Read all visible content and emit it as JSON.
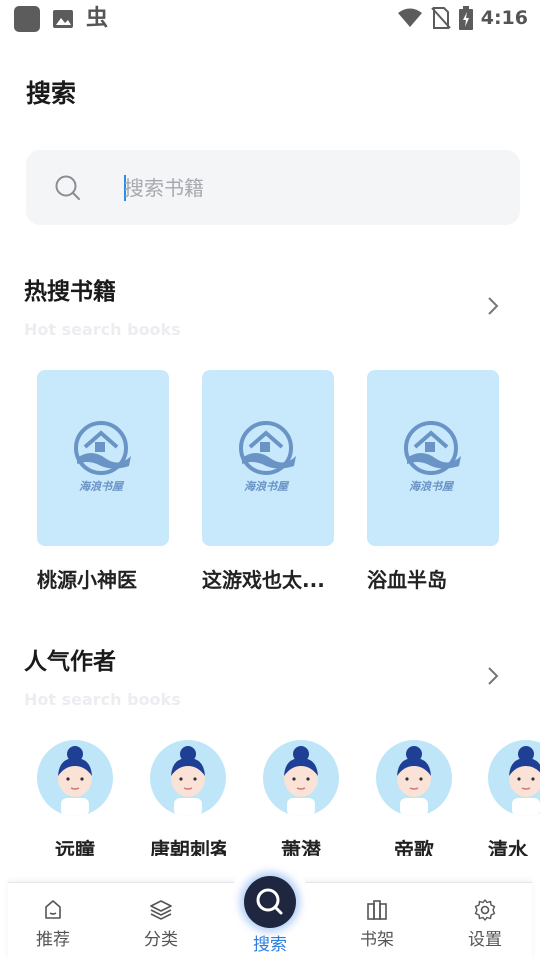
{
  "status_bar": {
    "time": "4:16",
    "left_icons": [
      "app-square-icon",
      "image-icon",
      "bug-icon"
    ],
    "right_icons": [
      "wifi-icon",
      "no-sim-icon",
      "battery-charging-icon"
    ],
    "bug_glyph": "虫"
  },
  "page": {
    "title": "搜索"
  },
  "search": {
    "placeholder": "搜索书籍"
  },
  "hot_books": {
    "title": "热搜书籍",
    "subtitle": "Hot search books",
    "books": [
      {
        "title": "桃源小神医",
        "cover_logo_text": "海浪书屋"
      },
      {
        "title": "这游戏也太...",
        "cover_logo_text": "海浪书屋"
      },
      {
        "title": "浴血半岛",
        "cover_logo_text": "海浪书屋"
      }
    ]
  },
  "popular_authors": {
    "title": "人气作者",
    "subtitle": "Hot search books",
    "authors": [
      {
        "name": "远瞳"
      },
      {
        "name": "唐朝刺客"
      },
      {
        "name": "萧潜"
      },
      {
        "name": "帝歌"
      },
      {
        "name": "清水"
      }
    ]
  },
  "bottom_nav": {
    "items": [
      {
        "label": "推荐",
        "icon": "home-icon"
      },
      {
        "label": "分类",
        "icon": "layers-icon"
      },
      {
        "label": "搜索",
        "icon": "search-icon",
        "active": true
      },
      {
        "label": "书架",
        "icon": "bookshelf-icon"
      },
      {
        "label": "设置",
        "icon": "gear-icon"
      }
    ]
  },
  "colors": {
    "accent": "#2a7de1",
    "cover_bg": "#c8e9fb",
    "avatar_bg": "#bfe6f8",
    "search_bg": "#f4f5f7",
    "nav_center_bg": "#1f2740"
  }
}
